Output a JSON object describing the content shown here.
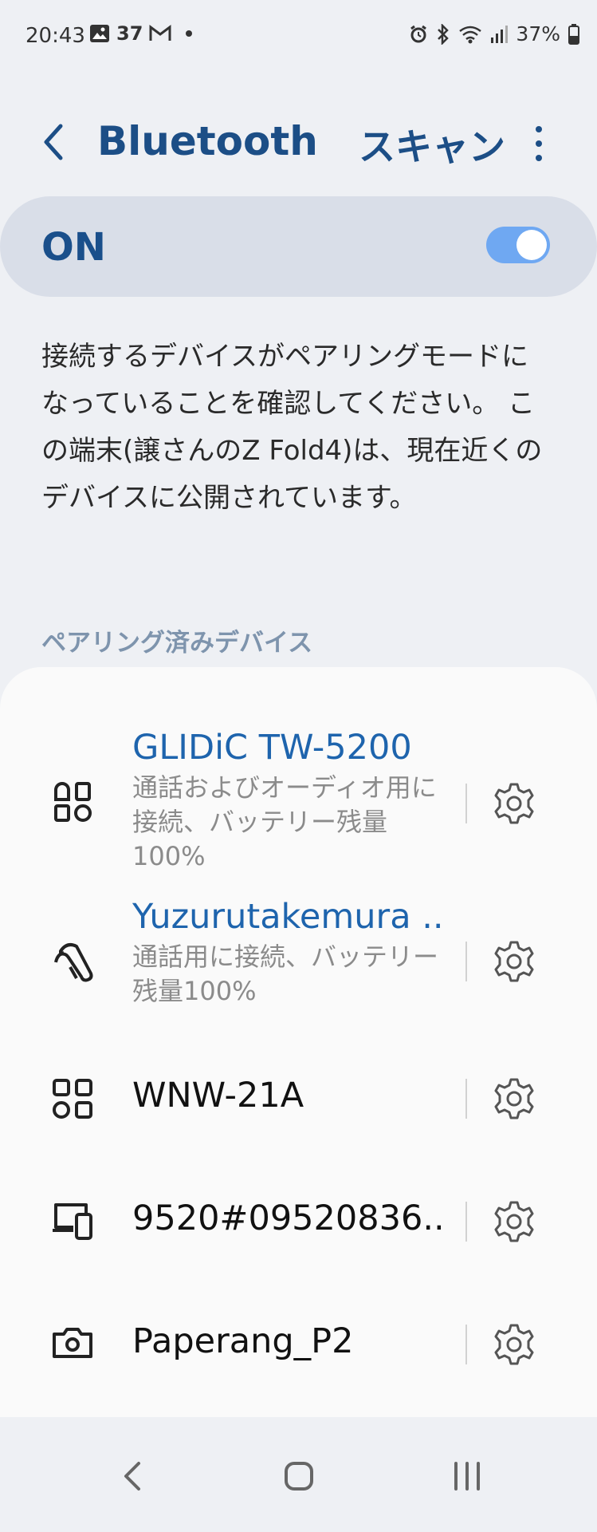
{
  "status_bar": {
    "time": "20:43",
    "mail_count": "37",
    "battery": "37%"
  },
  "app_bar": {
    "title": "Bluetooth",
    "scan_label": "スキャン"
  },
  "toggle": {
    "label": "ON",
    "state": "on",
    "accent": "#6fa8f2"
  },
  "description": "接続するデバイスがペアリングモードになっていることを確認してください。 この端末(譲さんのZ Fold4)は、現在近くのデバイスに公開されています。",
  "paired_section": {
    "header": "ペアリング済みデバイス",
    "devices": [
      {
        "name": "GLIDiC TW-5200",
        "status": "通話およびオーディオ用に接続、バッテリー残量100%",
        "icon": "earbuds-icon",
        "connected": true
      },
      {
        "name": "Yuzurutakemura ..",
        "status": "通話用に接続、バッテリー残量100%",
        "icon": "headset-icon",
        "connected": true
      },
      {
        "name": "WNW-21A",
        "status": "",
        "icon": "apps-icon",
        "connected": false
      },
      {
        "name": "9520#09520836..",
        "status": "",
        "icon": "devices-icon",
        "connected": false
      },
      {
        "name": "Paperang_P2",
        "status": "",
        "icon": "camera-icon",
        "connected": false
      }
    ]
  }
}
